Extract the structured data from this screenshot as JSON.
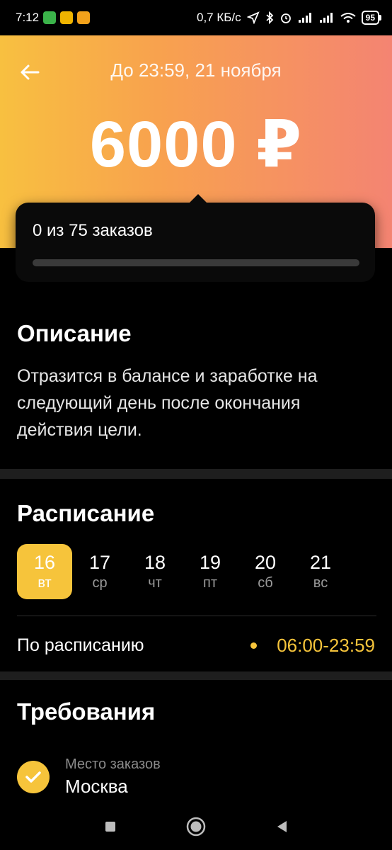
{
  "status_bar": {
    "time": "7:12",
    "network_speed": "0,7 КБ/с",
    "battery_level": "95",
    "icons": [
      "shield-app-icon",
      "wallet-app-icon",
      "n-app-icon",
      "location-icon",
      "bluetooth-icon",
      "alarm-icon",
      "signal-icon",
      "signal-icon",
      "wifi-icon",
      "battery-icon"
    ]
  },
  "header": {
    "deadline": "До 23:59, 21 ноября",
    "amount": "6000 ₽",
    "back_icon": "arrow-left-icon"
  },
  "progress": {
    "text": "0 из 75 заказов",
    "done": 0,
    "total": 75
  },
  "description": {
    "title": "Описание",
    "text": "Отразится в балансе и заработке на следующий день после окончания действия цели."
  },
  "schedule": {
    "title": "Расписание",
    "days": [
      {
        "num": "16",
        "weekday": "вт",
        "selected": true
      },
      {
        "num": "17",
        "weekday": "ср",
        "selected": false
      },
      {
        "num": "18",
        "weekday": "чт",
        "selected": false
      },
      {
        "num": "19",
        "weekday": "пт",
        "selected": false
      },
      {
        "num": "20",
        "weekday": "сб",
        "selected": false
      },
      {
        "num": "21",
        "weekday": "вс",
        "selected": false
      }
    ],
    "row_label": "По расписанию",
    "row_time": "06:00-23:59"
  },
  "requirements": {
    "title": "Требования",
    "items": [
      {
        "label": "Место заказов",
        "value": "Москва",
        "icon": "check-icon"
      }
    ]
  },
  "colors": {
    "accent": "#f6c43b",
    "gradient_start": "#f8c040",
    "gradient_end": "#f48472"
  },
  "navbar": {
    "icons": [
      "recents-square-icon",
      "home-circle-icon",
      "back-triangle-icon"
    ]
  }
}
